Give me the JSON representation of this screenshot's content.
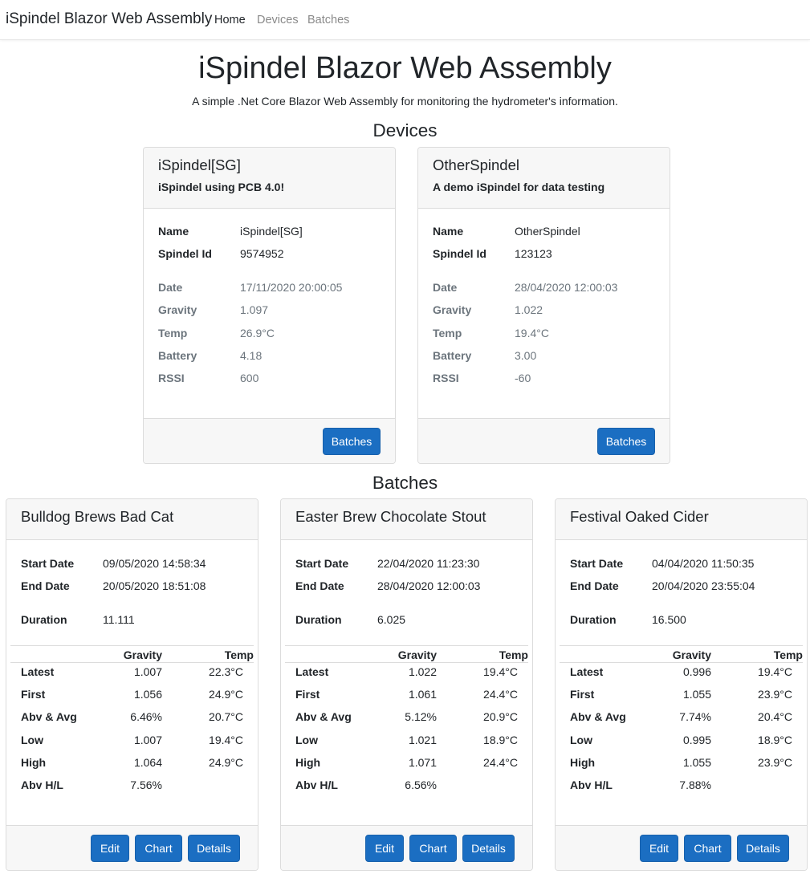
{
  "nav": {
    "brand": "iSpindel Blazor Web Assembly",
    "links": [
      "Home",
      "Devices",
      "Batches"
    ]
  },
  "header": {
    "title": "iSpindel Blazor Web Assembly",
    "subtitle": "A simple .Net Core Blazor Web Assembly for monitoring the hydrometer's information."
  },
  "devices_section": {
    "title": "Devices"
  },
  "devices": [
    {
      "title": "iSpindel[SG]",
      "subtitle": "iSpindel using PCB 4.0!",
      "name_label": "Name",
      "name": "iSpindel[SG]",
      "id_label": "Spindel Id",
      "id": "9574952",
      "date_label": "Date",
      "date": "17/11/2020 20:00:05",
      "gravity_label": "Gravity",
      "gravity": "1.097",
      "temp_label": "Temp",
      "temp": "26.9°C",
      "battery_label": "Battery",
      "battery": "4.18",
      "rssi_label": "RSSI",
      "rssi": "600",
      "button": "Batches"
    },
    {
      "title": "OtherSpindel",
      "subtitle": "A demo iSpindel for data testing",
      "name_label": "Name",
      "name": "OtherSpindel",
      "id_label": "Spindel Id",
      "id": "123123",
      "date_label": "Date",
      "date": "28/04/2020 12:00:03",
      "gravity_label": "Gravity",
      "gravity": "1.022",
      "temp_label": "Temp",
      "temp": "19.4°C",
      "battery_label": "Battery",
      "battery": "3.00",
      "rssi_label": "RSSI",
      "rssi": "-60",
      "button": "Batches"
    }
  ],
  "batches_section": {
    "title": "Batches"
  },
  "batches": [
    {
      "title": "Bulldog Brews Bad Cat",
      "start_label": "Start Date",
      "start": "09/05/2020 14:58:34",
      "end_label": "End Date",
      "end": "20/05/2020 18:51:08",
      "duration_label": "Duration",
      "duration": "11.111",
      "col_gravity": "Gravity",
      "col_temp": "Temp",
      "rows": [
        {
          "label": "Latest",
          "gravity": "1.007",
          "temp": "22.3°C"
        },
        {
          "label": "First",
          "gravity": "1.056",
          "temp": "24.9°C"
        },
        {
          "label": "Abv & Avg",
          "gravity": "6.46%",
          "temp": "20.7°C"
        },
        {
          "label": "Low",
          "gravity": "1.007",
          "temp": "19.4°C"
        },
        {
          "label": "High",
          "gravity": "1.064",
          "temp": "24.9°C"
        },
        {
          "label": "Abv H/L",
          "gravity": "7.56%",
          "temp": ""
        }
      ],
      "buttons": {
        "edit": "Edit",
        "chart": "Chart",
        "details": "Details"
      }
    },
    {
      "title": "Easter Brew Chocolate Stout",
      "start_label": "Start Date",
      "start": "22/04/2020 11:23:30",
      "end_label": "End Date",
      "end": "28/04/2020 12:00:03",
      "duration_label": "Duration",
      "duration": "6.025",
      "col_gravity": "Gravity",
      "col_temp": "Temp",
      "rows": [
        {
          "label": "Latest",
          "gravity": "1.022",
          "temp": "19.4°C"
        },
        {
          "label": "First",
          "gravity": "1.061",
          "temp": "24.4°C"
        },
        {
          "label": "Abv & Avg",
          "gravity": "5.12%",
          "temp": "20.9°C"
        },
        {
          "label": "Low",
          "gravity": "1.021",
          "temp": "18.9°C"
        },
        {
          "label": "High",
          "gravity": "1.071",
          "temp": "24.4°C"
        },
        {
          "label": "Abv H/L",
          "gravity": "6.56%",
          "temp": ""
        }
      ],
      "buttons": {
        "edit": "Edit",
        "chart": "Chart",
        "details": "Details"
      }
    },
    {
      "title": "Festival Oaked Cider",
      "start_label": "Start Date",
      "start": "04/04/2020 11:50:35",
      "end_label": "End Date",
      "end": "20/04/2020 23:55:04",
      "duration_label": "Duration",
      "duration": "16.500",
      "col_gravity": "Gravity",
      "col_temp": "Temp",
      "rows": [
        {
          "label": "Latest",
          "gravity": "0.996",
          "temp": "19.4°C"
        },
        {
          "label": "First",
          "gravity": "1.055",
          "temp": "23.9°C"
        },
        {
          "label": "Abv & Avg",
          "gravity": "7.74%",
          "temp": "20.4°C"
        },
        {
          "label": "Low",
          "gravity": "0.995",
          "temp": "18.9°C"
        },
        {
          "label": "High",
          "gravity": "1.055",
          "temp": "23.9°C"
        },
        {
          "label": "Abv H/L",
          "gravity": "7.88%",
          "temp": ""
        }
      ],
      "buttons": {
        "edit": "Edit",
        "chart": "Chart",
        "details": "Details"
      }
    }
  ]
}
